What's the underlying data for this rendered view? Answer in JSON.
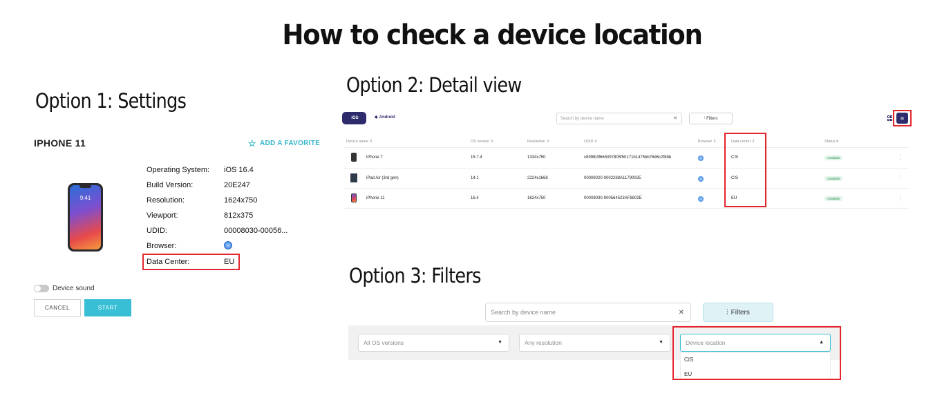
{
  "title": "How to check a device location",
  "option1": {
    "heading": "Option 1: Settings",
    "device_name": "IPHONE 11",
    "add_favorite": "ADD A FAVORITE",
    "phone_time": "9:41",
    "specs": [
      {
        "label": "Operating System:",
        "value": "iOS 16.4"
      },
      {
        "label": "Build Version:",
        "value": "20E247"
      },
      {
        "label": "Resolution:",
        "value": "1624x750"
      },
      {
        "label": "Viewport:",
        "value": "812x375"
      },
      {
        "label": "UDID:",
        "value": "00008030-00056..."
      },
      {
        "label": "Browser:",
        "value": ""
      },
      {
        "label": "Data Center:",
        "value": "EU"
      }
    ],
    "device_sound": "Device sound",
    "cancel": "CANCEL",
    "start": "START",
    "accent_color": "#38bfd6",
    "highlight_color": "#e3262d"
  },
  "option2": {
    "heading": "Option 2: Detail view",
    "tab_ios": "iOS",
    "tab_android": "Android",
    "search_placeholder": "Search by device name",
    "filters": "Filters",
    "columns": {
      "device_name": "Device name",
      "os_version": "OS version",
      "resolution": "Resolution",
      "udid": "UDID",
      "browser": "Browser",
      "data_center": "Data center",
      "status": "Status"
    },
    "rows": [
      {
        "device": "iPhone 7",
        "os": "15.7.4",
        "resolution": "1334x750",
        "udid": "c89f8b3f665097805f50171b1475bb76d6c2f8bb",
        "data_center": "CIS",
        "status": "Available"
      },
      {
        "device": "iPad Air (3rd gen)",
        "os": "14.1",
        "resolution": "2224x1668",
        "udid": "00008020-0002288A1179002E",
        "data_center": "CIS",
        "status": "Available"
      },
      {
        "device": "iPhone 11",
        "os": "16.4",
        "resolution": "1624x750",
        "udid": "00008030-000564523AF8802E",
        "data_center": "EU",
        "status": "Available"
      }
    ],
    "brand_color": "#2d2b6b"
  },
  "option3": {
    "heading": "Option 3: Filters",
    "search_placeholder": "Search by device name",
    "filters": "Filters",
    "os_select": "All OS versions",
    "resolution_select": "Any resolution",
    "location_select": "Device location",
    "location_options": [
      "CIS",
      "EU"
    ]
  }
}
